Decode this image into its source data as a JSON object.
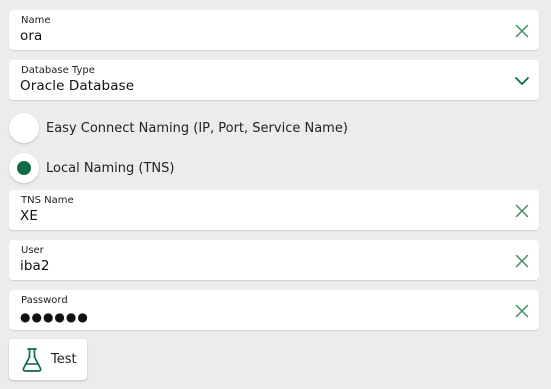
{
  "colors": {
    "accent": "#0d6b45",
    "clear_icon": "#3f8f66",
    "background": "#ececec",
    "card": "#ffffff"
  },
  "name_field": {
    "label": "Name",
    "value": "ora",
    "clear_icon": "close-icon"
  },
  "database_type": {
    "label": "Database Type",
    "value": "Oracle Database",
    "dropdown_icon": "chevron-down-icon"
  },
  "naming_options": [
    {
      "label": "Easy Connect Naming (IP, Port, Service Name)",
      "selected": false
    },
    {
      "label": "Local Naming (TNS)",
      "selected": true
    }
  ],
  "tns_field": {
    "label": "TNS Name",
    "value": "XE",
    "clear_icon": "close-icon"
  },
  "user_field": {
    "label": "User",
    "value": "iba2",
    "clear_icon": "close-icon"
  },
  "password_field": {
    "label": "Password",
    "value": "●●●●●●",
    "clear_icon": "close-icon"
  },
  "test_button": {
    "label": "Test",
    "icon": "flask-icon"
  }
}
